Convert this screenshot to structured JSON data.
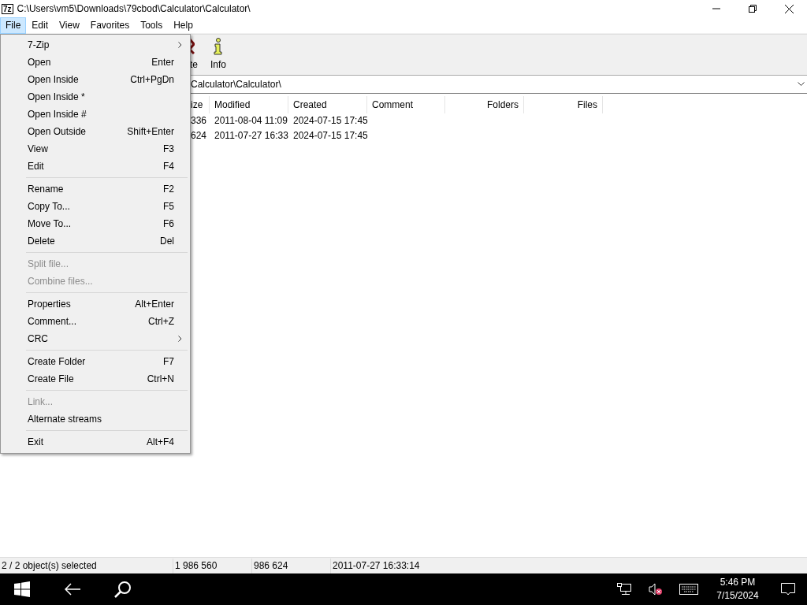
{
  "window": {
    "logo": "7z",
    "title": "C:\\Users\\vm5\\Downloads\\79cbod\\Calculator\\Calculator\\"
  },
  "menubar": [
    {
      "label": "File",
      "selected": true
    },
    {
      "label": "Edit",
      "selected": false
    },
    {
      "label": "View",
      "selected": false
    },
    {
      "label": "Favorites",
      "selected": false
    },
    {
      "label": "Tools",
      "selected": false
    },
    {
      "label": "Help",
      "selected": false
    }
  ],
  "file_menu": [
    {
      "kind": "item",
      "label": "7-Zip",
      "submenu": true,
      "disabled": false
    },
    {
      "kind": "item",
      "label": "Open",
      "shortcut": "Enter",
      "disabled": false
    },
    {
      "kind": "item",
      "label": "Open Inside",
      "shortcut": "Ctrl+PgDn",
      "disabled": false
    },
    {
      "kind": "item",
      "label": "Open Inside *",
      "disabled": false
    },
    {
      "kind": "item",
      "label": "Open Inside #",
      "disabled": false
    },
    {
      "kind": "item",
      "label": "Open Outside",
      "shortcut": "Shift+Enter",
      "disabled": false
    },
    {
      "kind": "item",
      "label": "View",
      "shortcut": "F3",
      "disabled": false
    },
    {
      "kind": "item",
      "label": "Edit",
      "shortcut": "F4",
      "disabled": false
    },
    {
      "kind": "separator"
    },
    {
      "kind": "item",
      "label": "Rename",
      "shortcut": "F2",
      "disabled": false
    },
    {
      "kind": "item",
      "label": "Copy To...",
      "shortcut": "F5",
      "disabled": false
    },
    {
      "kind": "item",
      "label": "Move To...",
      "shortcut": "F6",
      "disabled": false
    },
    {
      "kind": "item",
      "label": "Delete",
      "shortcut": "Del",
      "disabled": false
    },
    {
      "kind": "separator"
    },
    {
      "kind": "item",
      "label": "Split file...",
      "disabled": true
    },
    {
      "kind": "item",
      "label": "Combine files...",
      "disabled": true
    },
    {
      "kind": "separator"
    },
    {
      "kind": "item",
      "label": "Properties",
      "shortcut": "Alt+Enter",
      "disabled": false
    },
    {
      "kind": "item",
      "label": "Comment...",
      "shortcut": "Ctrl+Z",
      "disabled": false
    },
    {
      "kind": "item",
      "label": "CRC",
      "submenu": true,
      "disabled": false
    },
    {
      "kind": "separator"
    },
    {
      "kind": "item",
      "label": "Create Folder",
      "shortcut": "F7",
      "disabled": false
    },
    {
      "kind": "item",
      "label": "Create File",
      "shortcut": "Ctrl+N",
      "disabled": false
    },
    {
      "kind": "separator"
    },
    {
      "kind": "item",
      "label": "Link...",
      "disabled": true
    },
    {
      "kind": "item",
      "label": "Alternate streams",
      "disabled": false
    },
    {
      "kind": "separator"
    },
    {
      "kind": "item",
      "label": "Exit",
      "shortcut": "Alt+F4",
      "disabled": false
    }
  ],
  "toolbar": [
    {
      "kind": "delete",
      "label": "te"
    },
    {
      "kind": "info",
      "label": "Info"
    }
  ],
  "address": "Calculator\\Calculator\\",
  "columns": [
    "ize",
    "Modified",
    "Created",
    "Comment",
    "Folders",
    "Files"
  ],
  "rows": [
    [
      "336",
      "2011-08-04 11:09",
      "2024-07-15 17:45"
    ],
    [
      "624",
      "2011-07-27 16:33",
      "2024-07-15 17:45"
    ]
  ],
  "status_bar": [
    "2 / 2 object(s) selected",
    "1 986 560",
    "986 624",
    "2011-07-27 16:33:14"
  ],
  "taskbar": {
    "time": "5:46 PM",
    "date": "7/15/2024"
  }
}
